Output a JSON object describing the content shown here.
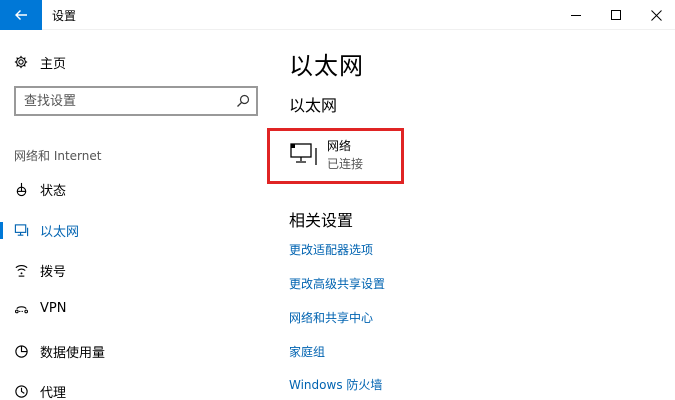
{
  "window": {
    "title": "设置"
  },
  "sidebar": {
    "home_label": "主页",
    "search_placeholder": "查找设置",
    "section_label": "网络和 Internet",
    "items": [
      {
        "label": "状态",
        "icon": "status-icon"
      },
      {
        "label": "以太网",
        "icon": "ethernet-icon",
        "active": true
      },
      {
        "label": "拨号",
        "icon": "dialup-icon"
      },
      {
        "label": "VPN",
        "icon": "vpn-icon"
      },
      {
        "label": "数据使用量",
        "icon": "data-usage-icon"
      },
      {
        "label": "代理",
        "icon": "proxy-icon"
      }
    ]
  },
  "main": {
    "title": "以太网",
    "subtitle": "以太网",
    "network": {
      "name": "网络",
      "status": "已连接"
    },
    "related_title": "相关设置",
    "links": [
      "更改适配器选项",
      "更改高级共享设置",
      "网络和共享中心",
      "家庭组",
      "Windows 防火墙"
    ]
  },
  "colors": {
    "accent": "#0078d7",
    "link": "#0063b1",
    "highlight": "#e02424"
  }
}
